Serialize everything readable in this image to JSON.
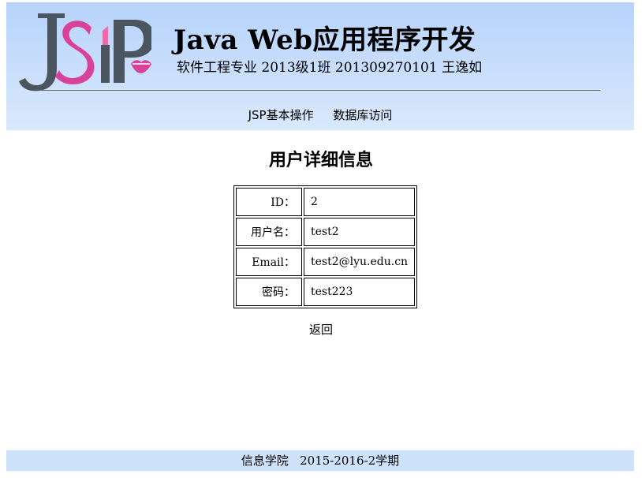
{
  "header": {
    "logo_text": "JSP",
    "title": "Java Web应用程序开发",
    "subtitle": "软件工程专业 2013级1班 201309270101 王逸如"
  },
  "nav": {
    "items": [
      {
        "label": "JSP基本操作"
      },
      {
        "label": "数据库访问"
      }
    ]
  },
  "main": {
    "heading": "用户详细信息",
    "rows": [
      {
        "label": "ID：",
        "value": "2"
      },
      {
        "label": "用户名：",
        "value": "test2"
      },
      {
        "label": "Email：",
        "value": "test2@lyu.edu.cn"
      },
      {
        "label": "密码：",
        "value": "test223"
      }
    ],
    "back_label": "返回"
  },
  "footer": {
    "text": "信息学院   2015-2016-2学期"
  },
  "colors": {
    "header_bg": "#b7d3fb",
    "footer_bg": "#cfe2fc",
    "logo_gray": "#4a5560",
    "logo_pink": "#d8429a"
  }
}
